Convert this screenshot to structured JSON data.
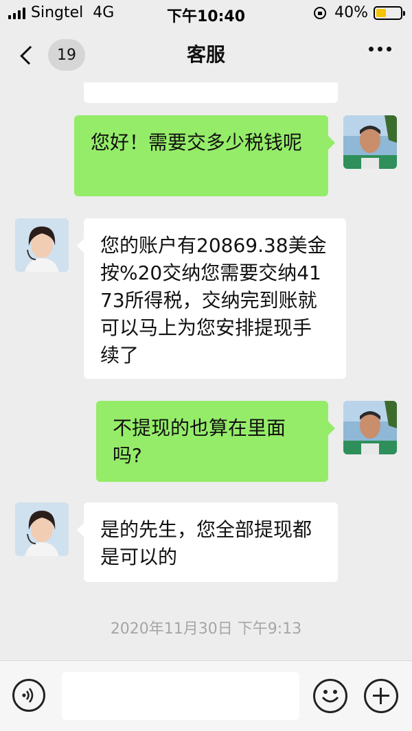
{
  "status_bar": {
    "carrier": "Singtel",
    "network": "4G",
    "time": "下午10:40",
    "battery_percent": "40%",
    "battery_level": 0.4
  },
  "nav": {
    "unread_count": "19",
    "title": "客服"
  },
  "messages": [
    {
      "sender": "agent",
      "text": ""
    },
    {
      "sender": "me",
      "text": "您好！需要交多少税钱呢"
    },
    {
      "sender": "agent",
      "text": "您的账户有20869.38美金按%20交纳您需要交纳4173所得税，交纳完到账就可以马上为您安排提现手续了"
    },
    {
      "sender": "me",
      "text": "不提现的也算在里面吗?"
    },
    {
      "sender": "agent",
      "text": "是的先生，您全部提现都是可以的"
    }
  ],
  "timestamp": "2020年11月30日 下午9:13",
  "input": {
    "value": "",
    "placeholder": ""
  },
  "colors": {
    "background": "#ededed",
    "my_bubble": "#95ec69",
    "agent_bubble": "#ffffff",
    "battery": "#f5c400"
  },
  "icons": {
    "back": "chevron-left-icon",
    "more": "more-dots-icon",
    "voice": "voice-icon",
    "emoji": "emoji-icon",
    "plus": "plus-icon"
  }
}
